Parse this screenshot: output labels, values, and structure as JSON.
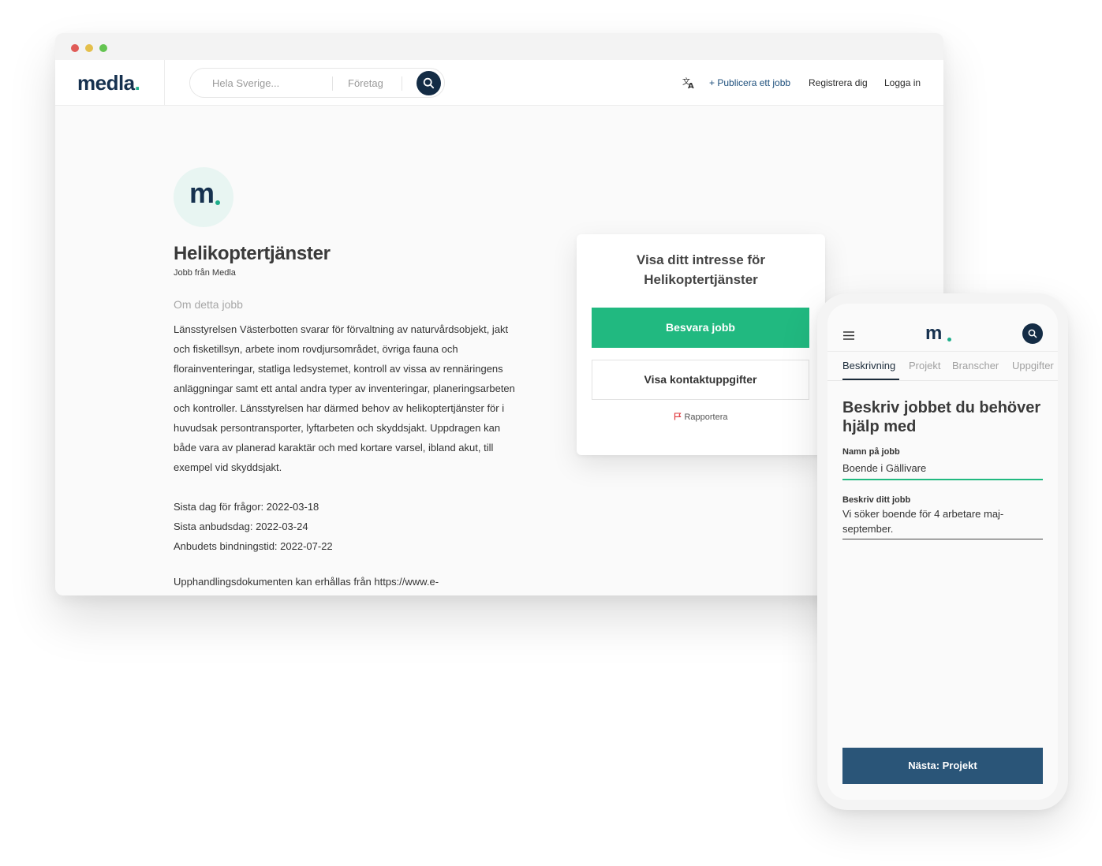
{
  "colors": {
    "brand_navy": "#16314f",
    "brand_teal": "#1fae8b",
    "primary_green": "#21b980",
    "phone_button_blue": "#2a5578"
  },
  "browser": {
    "logo": {
      "text": "medla",
      "dot": "."
    },
    "search": {
      "location_placeholder": "Hela Sverige...",
      "company_placeholder": "Företag",
      "icon": "search-icon"
    },
    "nav": {
      "translate_icon": "translate-icon",
      "publish": "+ Publicera ett jobb",
      "register": "Registrera dig",
      "login": "Logga in"
    },
    "job": {
      "avatar_letter": "m",
      "title": "Helikoptertjänster",
      "subtitle": "Jobb från Medla",
      "about_heading": "Om detta jobb",
      "description_lines": [
        "Länsstyrelsen Västerbotten svarar för förvaltning av naturvårdsobjekt, jakt",
        "och fisketillsyn, arbete inom rovdjursområdet, övriga fauna och",
        "florainventeringar, statliga ledsystemet, kontroll av vissa av rennäringens",
        "anläggningar samt ett antal andra typer av inventeringar, planeringsarbeten",
        "och kontroller. Länsstyrelsen har därmed behov av helikoptertjänster för i",
        "huvudsak persontransporter, lyftarbeten och skyddsjakt. Uppdragen kan",
        "både vara av planerad karaktär och med kortare varsel, ibland akut, till",
        "exempel vid skyddsjakt."
      ],
      "questions_deadline": "Sista dag för frågor: 2022-03-18",
      "bid_deadline": "Sista anbudsdag: 2022-03-24",
      "binding_period": "Anbudets bindningstid: 2022-07-22",
      "documents_text": "Upphandlingsdokumenten kan erhållas från https://www.e-"
    },
    "interest_card": {
      "title_line1": "Visa ditt intresse för",
      "title_line2": "Helikoptertjänster",
      "answer_button": "Besvara jobb",
      "contact_button": "Visa kontaktuppgifter",
      "report_link": "Rapportera",
      "report_icon": "flag-icon"
    }
  },
  "phone": {
    "logo": {
      "text": "m",
      "dot": "."
    },
    "menu_icon": "hamburger-menu-icon",
    "search_icon": "search-icon",
    "tabs": [
      {
        "label": "Beskrivning",
        "active": true
      },
      {
        "label": "Projekt",
        "active": false
      },
      {
        "label": "Branscher",
        "active": false
      },
      {
        "label": "Uppgifter",
        "active": false
      }
    ],
    "heading": "Beskriv jobbet du behöver hjälp med",
    "field_name": {
      "label": "Namn på jobb",
      "value": "Boende i Gällivare"
    },
    "field_description": {
      "label": "Beskriv ditt jobb",
      "value": "Vi söker boende för 4 arbetare maj-september."
    },
    "next_button": "Nästa: Projekt"
  }
}
